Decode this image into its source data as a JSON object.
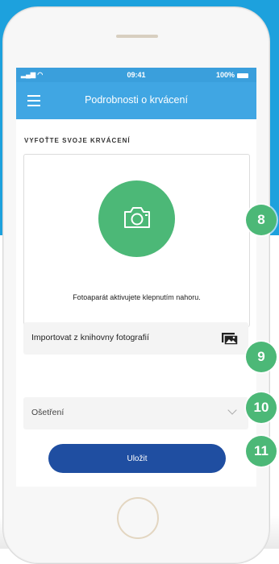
{
  "status_bar": {
    "time": "09:41",
    "battery": "100%"
  },
  "nav": {
    "title": "Podrobnosti o krvácení"
  },
  "photo_section": {
    "label": "VYFOŤTE SVOJE KRVÁCENÍ",
    "hint": "Fotoaparát aktivujete klepnutím nahoru."
  },
  "import": {
    "label": "Importovat z knihovny fotografií"
  },
  "treatment": {
    "placeholder": "Ošetření"
  },
  "save": {
    "label": "Uložit"
  },
  "badges": [
    "8",
    "9",
    "10",
    "11"
  ],
  "colors": {
    "accent_green": "#4cb877",
    "nav_blue": "#40a6e3",
    "button_blue": "#1f4ea1",
    "background_blue": "#1da1dd"
  }
}
